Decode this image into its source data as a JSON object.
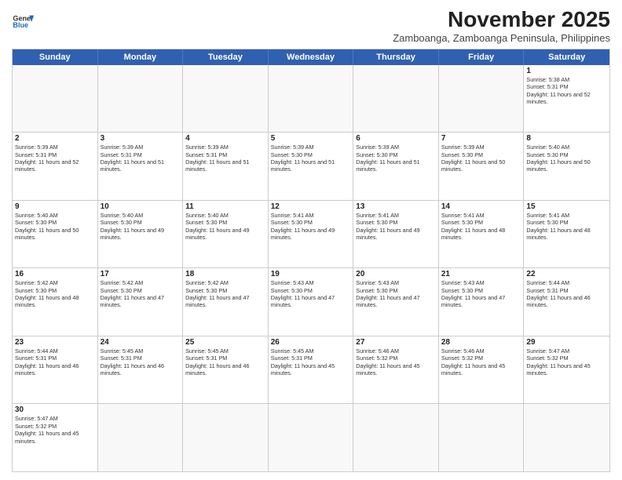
{
  "header": {
    "logo_line1": "General",
    "logo_line2": "Blue",
    "month_title": "November 2025",
    "subtitle": "Zamboanga, Zamboanga Peninsula, Philippines"
  },
  "days_of_week": [
    "Sunday",
    "Monday",
    "Tuesday",
    "Wednesday",
    "Thursday",
    "Friday",
    "Saturday"
  ],
  "weeks": [
    [
      {
        "day": "",
        "text": ""
      },
      {
        "day": "",
        "text": ""
      },
      {
        "day": "",
        "text": ""
      },
      {
        "day": "",
        "text": ""
      },
      {
        "day": "",
        "text": ""
      },
      {
        "day": "",
        "text": ""
      },
      {
        "day": "1",
        "text": "Sunrise: 5:38 AM\nSunset: 5:31 PM\nDaylight: 11 hours and 52 minutes."
      }
    ],
    [
      {
        "day": "2",
        "text": "Sunrise: 5:39 AM\nSunset: 5:31 PM\nDaylight: 11 hours and 52 minutes."
      },
      {
        "day": "3",
        "text": "Sunrise: 5:39 AM\nSunset: 5:31 PM\nDaylight: 11 hours and 51 minutes."
      },
      {
        "day": "4",
        "text": "Sunrise: 5:39 AM\nSunset: 5:31 PM\nDaylight: 11 hours and 51 minutes."
      },
      {
        "day": "5",
        "text": "Sunrise: 5:39 AM\nSunset: 5:30 PM\nDaylight: 11 hours and 51 minutes."
      },
      {
        "day": "6",
        "text": "Sunrise: 5:39 AM\nSunset: 5:30 PM\nDaylight: 11 hours and 51 minutes."
      },
      {
        "day": "7",
        "text": "Sunrise: 5:39 AM\nSunset: 5:30 PM\nDaylight: 11 hours and 50 minutes."
      },
      {
        "day": "8",
        "text": "Sunrise: 5:40 AM\nSunset: 5:30 PM\nDaylight: 11 hours and 50 minutes."
      }
    ],
    [
      {
        "day": "9",
        "text": "Sunrise: 5:40 AM\nSunset: 5:30 PM\nDaylight: 11 hours and 50 minutes."
      },
      {
        "day": "10",
        "text": "Sunrise: 5:40 AM\nSunset: 5:30 PM\nDaylight: 11 hours and 49 minutes."
      },
      {
        "day": "11",
        "text": "Sunrise: 5:40 AM\nSunset: 5:30 PM\nDaylight: 11 hours and 49 minutes."
      },
      {
        "day": "12",
        "text": "Sunrise: 5:41 AM\nSunset: 5:30 PM\nDaylight: 11 hours and 49 minutes."
      },
      {
        "day": "13",
        "text": "Sunrise: 5:41 AM\nSunset: 5:30 PM\nDaylight: 11 hours and 49 minutes."
      },
      {
        "day": "14",
        "text": "Sunrise: 5:41 AM\nSunset: 5:30 PM\nDaylight: 11 hours and 48 minutes."
      },
      {
        "day": "15",
        "text": "Sunrise: 5:41 AM\nSunset: 5:30 PM\nDaylight: 11 hours and 48 minutes."
      }
    ],
    [
      {
        "day": "16",
        "text": "Sunrise: 5:42 AM\nSunset: 5:30 PM\nDaylight: 11 hours and 48 minutes."
      },
      {
        "day": "17",
        "text": "Sunrise: 5:42 AM\nSunset: 5:30 PM\nDaylight: 11 hours and 47 minutes."
      },
      {
        "day": "18",
        "text": "Sunrise: 5:42 AM\nSunset: 5:30 PM\nDaylight: 11 hours and 47 minutes."
      },
      {
        "day": "19",
        "text": "Sunrise: 5:43 AM\nSunset: 5:30 PM\nDaylight: 11 hours and 47 minutes."
      },
      {
        "day": "20",
        "text": "Sunrise: 5:43 AM\nSunset: 5:30 PM\nDaylight: 11 hours and 47 minutes."
      },
      {
        "day": "21",
        "text": "Sunrise: 5:43 AM\nSunset: 5:30 PM\nDaylight: 11 hours and 47 minutes."
      },
      {
        "day": "22",
        "text": "Sunrise: 5:44 AM\nSunset: 5:31 PM\nDaylight: 11 hours and 46 minutes."
      }
    ],
    [
      {
        "day": "23",
        "text": "Sunrise: 5:44 AM\nSunset: 5:31 PM\nDaylight: 11 hours and 46 minutes."
      },
      {
        "day": "24",
        "text": "Sunrise: 5:45 AM\nSunset: 5:31 PM\nDaylight: 11 hours and 46 minutes."
      },
      {
        "day": "25",
        "text": "Sunrise: 5:45 AM\nSunset: 5:31 PM\nDaylight: 11 hours and 46 minutes."
      },
      {
        "day": "26",
        "text": "Sunrise: 5:45 AM\nSunset: 5:31 PM\nDaylight: 11 hours and 45 minutes."
      },
      {
        "day": "27",
        "text": "Sunrise: 5:46 AM\nSunset: 5:32 PM\nDaylight: 11 hours and 45 minutes."
      },
      {
        "day": "28",
        "text": "Sunrise: 5:46 AM\nSunset: 5:32 PM\nDaylight: 11 hours and 45 minutes."
      },
      {
        "day": "29",
        "text": "Sunrise: 5:47 AM\nSunset: 5:32 PM\nDaylight: 11 hours and 45 minutes."
      }
    ],
    [
      {
        "day": "30",
        "text": "Sunrise: 5:47 AM\nSunset: 5:32 PM\nDaylight: 11 hours and 45 minutes."
      },
      {
        "day": "",
        "text": ""
      },
      {
        "day": "",
        "text": ""
      },
      {
        "day": "",
        "text": ""
      },
      {
        "day": "",
        "text": ""
      },
      {
        "day": "",
        "text": ""
      },
      {
        "day": "",
        "text": ""
      }
    ]
  ]
}
